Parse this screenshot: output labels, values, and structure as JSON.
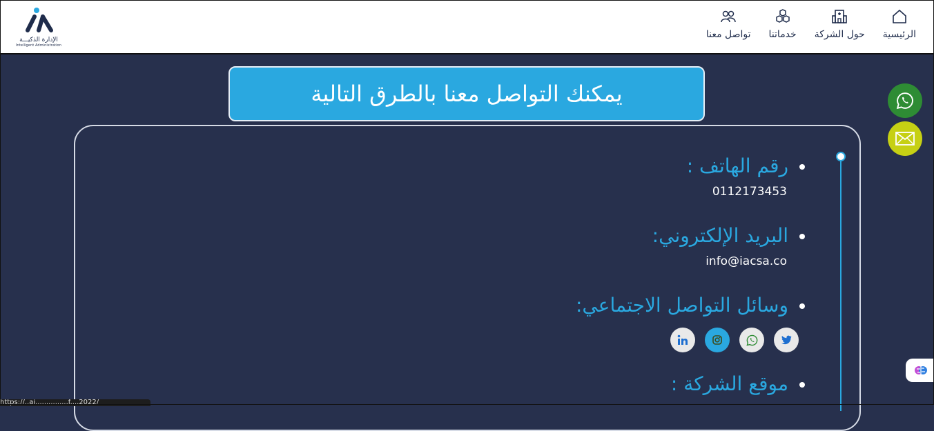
{
  "header": {
    "nav": [
      {
        "label": "الرئيسية",
        "icon": "home-icon"
      },
      {
        "label": "حول الشركة",
        "icon": "building-icon"
      },
      {
        "label": "خدماتنا",
        "icon": "cubes-icon"
      },
      {
        "label": "تواصل معنا",
        "icon": "users-icon"
      }
    ],
    "logo": {
      "ar": "الإدارة الذكيـــة",
      "en": "Intelligent Administration"
    }
  },
  "banner": {
    "title": "يمكنك التواصل معنا بالطرق التالية"
  },
  "contact": {
    "phone": {
      "label": "رقم الهاتف :",
      "value": "0112173453"
    },
    "email": {
      "label": "البريد الإلكتروني:",
      "value": "info@iacsa.co"
    },
    "social": {
      "label": "وسائل التواصل الاجتماعي:",
      "icons": [
        "twitter-icon",
        "whatsapp-icon",
        "instagram-icon",
        "linkedin-icon"
      ]
    },
    "location": {
      "label": "موقع الشركة :"
    }
  },
  "floating": {
    "whatsapp": "whatsapp-icon",
    "mail": "mail-icon",
    "assistant": "brain-icon"
  },
  "status_bar": {
    "url": "https://..ai...............f....2022/"
  },
  "colors": {
    "accent": "#2aa8e0",
    "background": "#27304d",
    "whatsapp": "#2e8c34",
    "mail": "#c6d014"
  }
}
